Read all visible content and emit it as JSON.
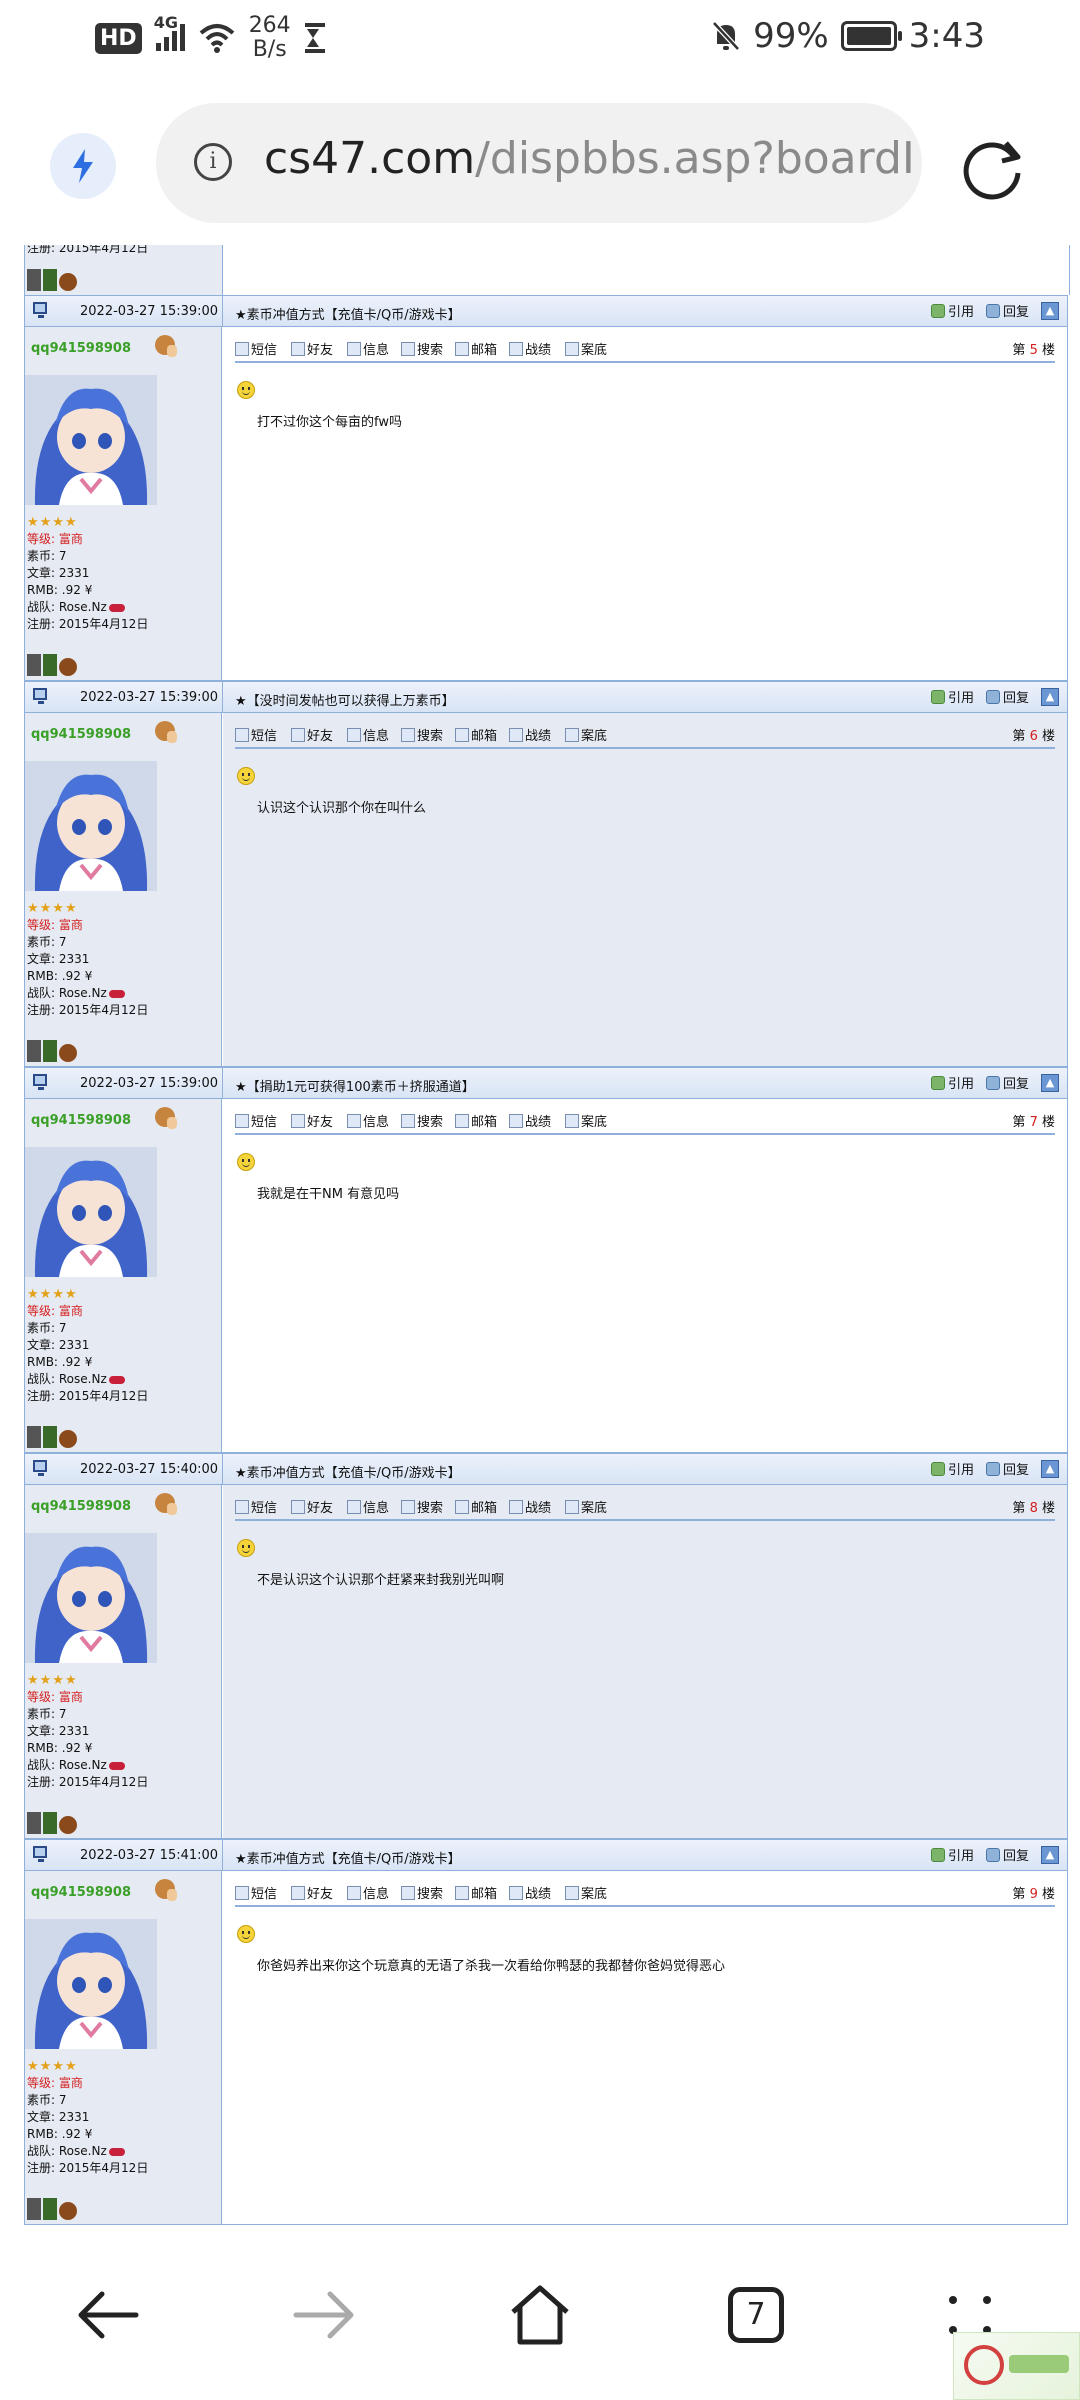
{
  "status": {
    "network_badge": "HD",
    "signal": "4G",
    "speed_value": "264",
    "speed_unit": "B/s",
    "battery": "99%",
    "time": "3:43"
  },
  "browser": {
    "url_host": "cs47.com",
    "url_path": "/dispbbs.asp?boardI",
    "tab_count": "7"
  },
  "toolbar": {
    "sms": "短信",
    "friend": "好友",
    "info": "信息",
    "search": "搜索",
    "mail": "邮箱",
    "record": "战绩",
    "case": "案底"
  },
  "actions": {
    "quote": "引用",
    "reply": "回复"
  },
  "user": {
    "name": "qq941598908",
    "stars": "★★★★",
    "level_label": "等级:",
    "level_value": "富商",
    "coin_label": "素币:",
    "coin_value": "7",
    "posts_label": "文章:",
    "posts_value": "2331",
    "rmb_label": "RMB:",
    "rmb_value": ".92 ¥",
    "clan_label": "战队:",
    "clan_value": "Rose.Nz",
    "reg_label": "注册:",
    "reg_value": "2015年4月12日"
  },
  "floor_prefix": "第",
  "floor_suffix": "楼",
  "posts": [
    {
      "time": "2022-03-27 15:39:00",
      "title": "★素币冲值方式【充值卡/Q币/游戏卡】",
      "floor": "5",
      "content": "打不过你这个每亩的fw吗"
    },
    {
      "time": "2022-03-27 15:39:00",
      "title": "★【没时间发帖也可以获得上万素币】",
      "floor": "6",
      "content": "认识这个认识那个你在叫什么"
    },
    {
      "time": "2022-03-27 15:39:00",
      "title": "★【捐助1元可获得100素币＋挤服通道】",
      "floor": "7",
      "content": "我就是在干NM 有意见吗"
    },
    {
      "time": "2022-03-27 15:40:00",
      "title": "★素币冲值方式【充值卡/Q币/游戏卡】",
      "floor": "8",
      "content": "不是认识这个认识那个赶紧来封我别光叫啊"
    },
    {
      "time": "2022-03-27 15:41:00",
      "title": "★素币冲值方式【充值卡/Q币/游戏卡】",
      "floor": "9",
      "content": "你爸妈养出来你这个玩意真的无语了杀我一次看给你鸭瑟的我都替你爸妈觉得恶心"
    }
  ],
  "prev_user": {
    "reg_fragment": "注册: 2015年4月12日"
  },
  "colors": {
    "border": "#8fb0da",
    "username": "#3aa028",
    "red": "#d42020",
    "alt_bg": "#e6eaf2"
  },
  "icons": [
    "lightning-icon",
    "info-icon",
    "reload-icon",
    "back-icon",
    "forward-icon",
    "home-icon",
    "tabs-icon",
    "menu-icon"
  ]
}
